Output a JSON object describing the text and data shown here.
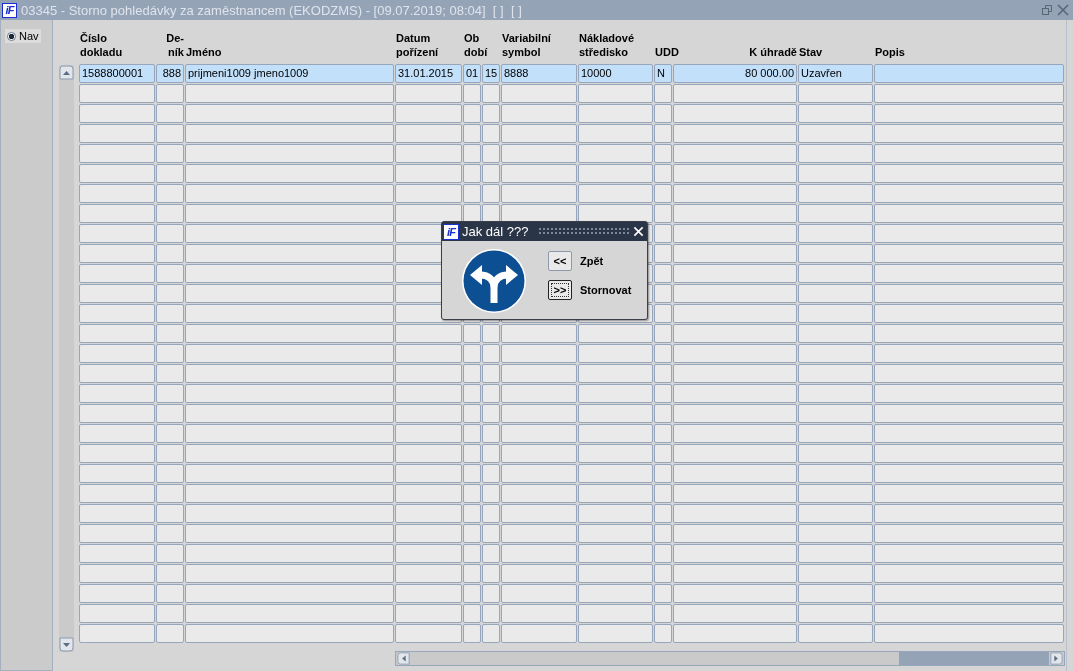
{
  "window": {
    "logo": "iF",
    "title": "03345 - Storno pohledávky za zaměstnancem (EKODZMS) - [09.07.2019; 08:04]  [ ]  [ ]"
  },
  "sidebar": {
    "radio": {
      "label": "Nav",
      "selected": true
    }
  },
  "table": {
    "columns": [
      {
        "header": "Číslo\ndokladu"
      },
      {
        "header": "De-\nník",
        "numeric": true
      },
      {
        "header": "Jméno"
      },
      {
        "header": "Datum\npořízení"
      },
      {
        "header": "Ob\ndobí",
        "split": true
      },
      {
        "header": "Variabilní\nsymbol"
      },
      {
        "header": "Nákladové\nstředisko"
      },
      {
        "header": "UDD"
      },
      {
        "header": "K úhradě",
        "numeric": true
      },
      {
        "header": "Stav"
      },
      {
        "header": "Popis"
      }
    ],
    "rows": [
      {
        "selected": true,
        "cells": [
          "1588800001",
          "888",
          "prijmeni1009 jmeno1009",
          "31.01.2015",
          [
            "01",
            "15"
          ],
          "8888",
          "10000",
          "N",
          "80 000.00",
          "Uzavřen"
        ]
      }
    ]
  },
  "dialog": {
    "logo": "iF",
    "title": "Jak dál ???",
    "actions": [
      {
        "button": "<<",
        "label": "Zpět",
        "focused": false
      },
      {
        "button": ">>",
        "label": "Stornovat",
        "focused": true
      }
    ]
  }
}
